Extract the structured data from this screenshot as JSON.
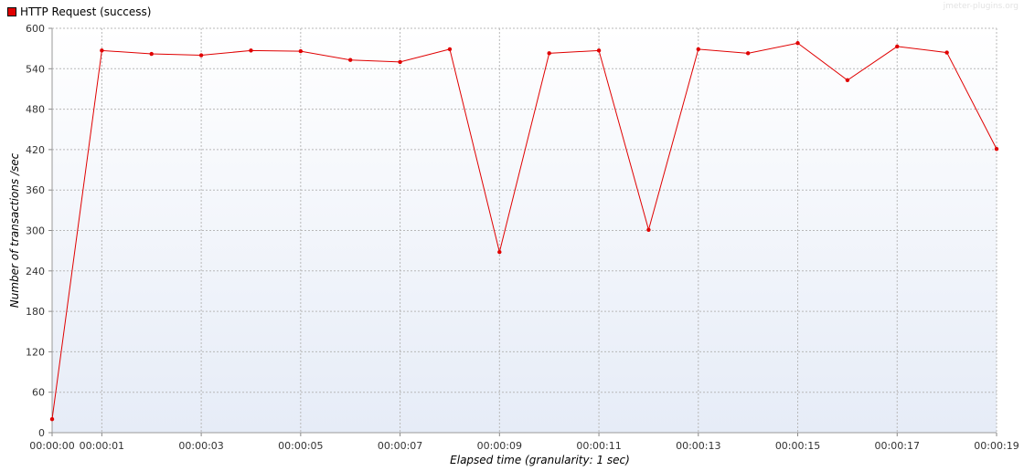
{
  "chart_data": {
    "type": "line",
    "xlabel": "Elapsed time (granularity: 1 sec)",
    "ylabel": "Number of transactions /sec",
    "ylim": [
      0,
      600
    ],
    "yticks": [
      0,
      60,
      120,
      180,
      240,
      300,
      360,
      420,
      480,
      540,
      600
    ],
    "xlim": [
      0,
      19
    ],
    "xticks": [
      0,
      1,
      3,
      5,
      7,
      9,
      11,
      13,
      15,
      17,
      19
    ],
    "xtick_labels": [
      "00:00:00",
      "00:00:01",
      "00:00:03",
      "00:00:05",
      "00:00:07",
      "00:00:09",
      "00:00:11",
      "00:00:13",
      "00:00:15",
      "00:00:17",
      "00:00:19"
    ],
    "grid": true,
    "legend_position": "top-left",
    "series": [
      {
        "name": "HTTP Request (success)",
        "color": "#e00000",
        "x": [
          0,
          1,
          2,
          3,
          4,
          5,
          6,
          7,
          8,
          9,
          10,
          11,
          12,
          13,
          14,
          15,
          16,
          17,
          18,
          19
        ],
        "values": [
          20,
          567,
          562,
          560,
          567,
          566,
          553,
          550,
          569,
          268,
          563,
          567,
          301,
          569,
          563,
          578,
          523,
          573,
          564,
          421
        ]
      }
    ]
  },
  "watermark": "jmeter-plugins.org"
}
